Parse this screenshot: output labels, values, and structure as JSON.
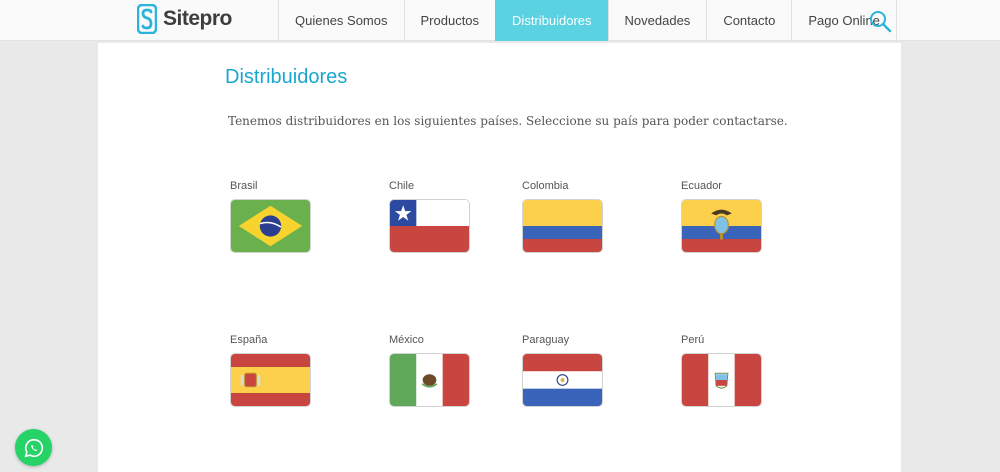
{
  "brand": {
    "name": "Sitepro",
    "accent": "#1aa7cf",
    "logo_color": "#2ab3dc"
  },
  "nav": {
    "items": [
      {
        "label": "Quienes Somos",
        "active": false
      },
      {
        "label": "Productos",
        "active": false
      },
      {
        "label": "Distribuidores",
        "active": true
      },
      {
        "label": "Novedades",
        "active": false
      },
      {
        "label": "Contacto",
        "active": false
      },
      {
        "label": "Pago Online",
        "active": false
      }
    ],
    "search_icon": "search-icon"
  },
  "page": {
    "title": "Distribuidores",
    "intro": "Tenemos distribuidores en los siguientes países. Seleccione su país para poder contactarse."
  },
  "countries": [
    {
      "name": "Brasil",
      "flag": "brazil-flag-icon"
    },
    {
      "name": "Chile",
      "flag": "chile-flag-icon"
    },
    {
      "name": "Colombia",
      "flag": "colombia-flag-icon"
    },
    {
      "name": "Ecuador",
      "flag": "ecuador-flag-icon"
    },
    {
      "name": "España",
      "flag": "spain-flag-icon"
    },
    {
      "name": "México",
      "flag": "mexico-flag-icon"
    },
    {
      "name": "Paraguay",
      "flag": "paraguay-flag-icon"
    },
    {
      "name": "Perú",
      "flag": "peru-flag-icon"
    }
  ],
  "whatsapp": {
    "icon": "whatsapp-icon",
    "color": "#25d366"
  }
}
